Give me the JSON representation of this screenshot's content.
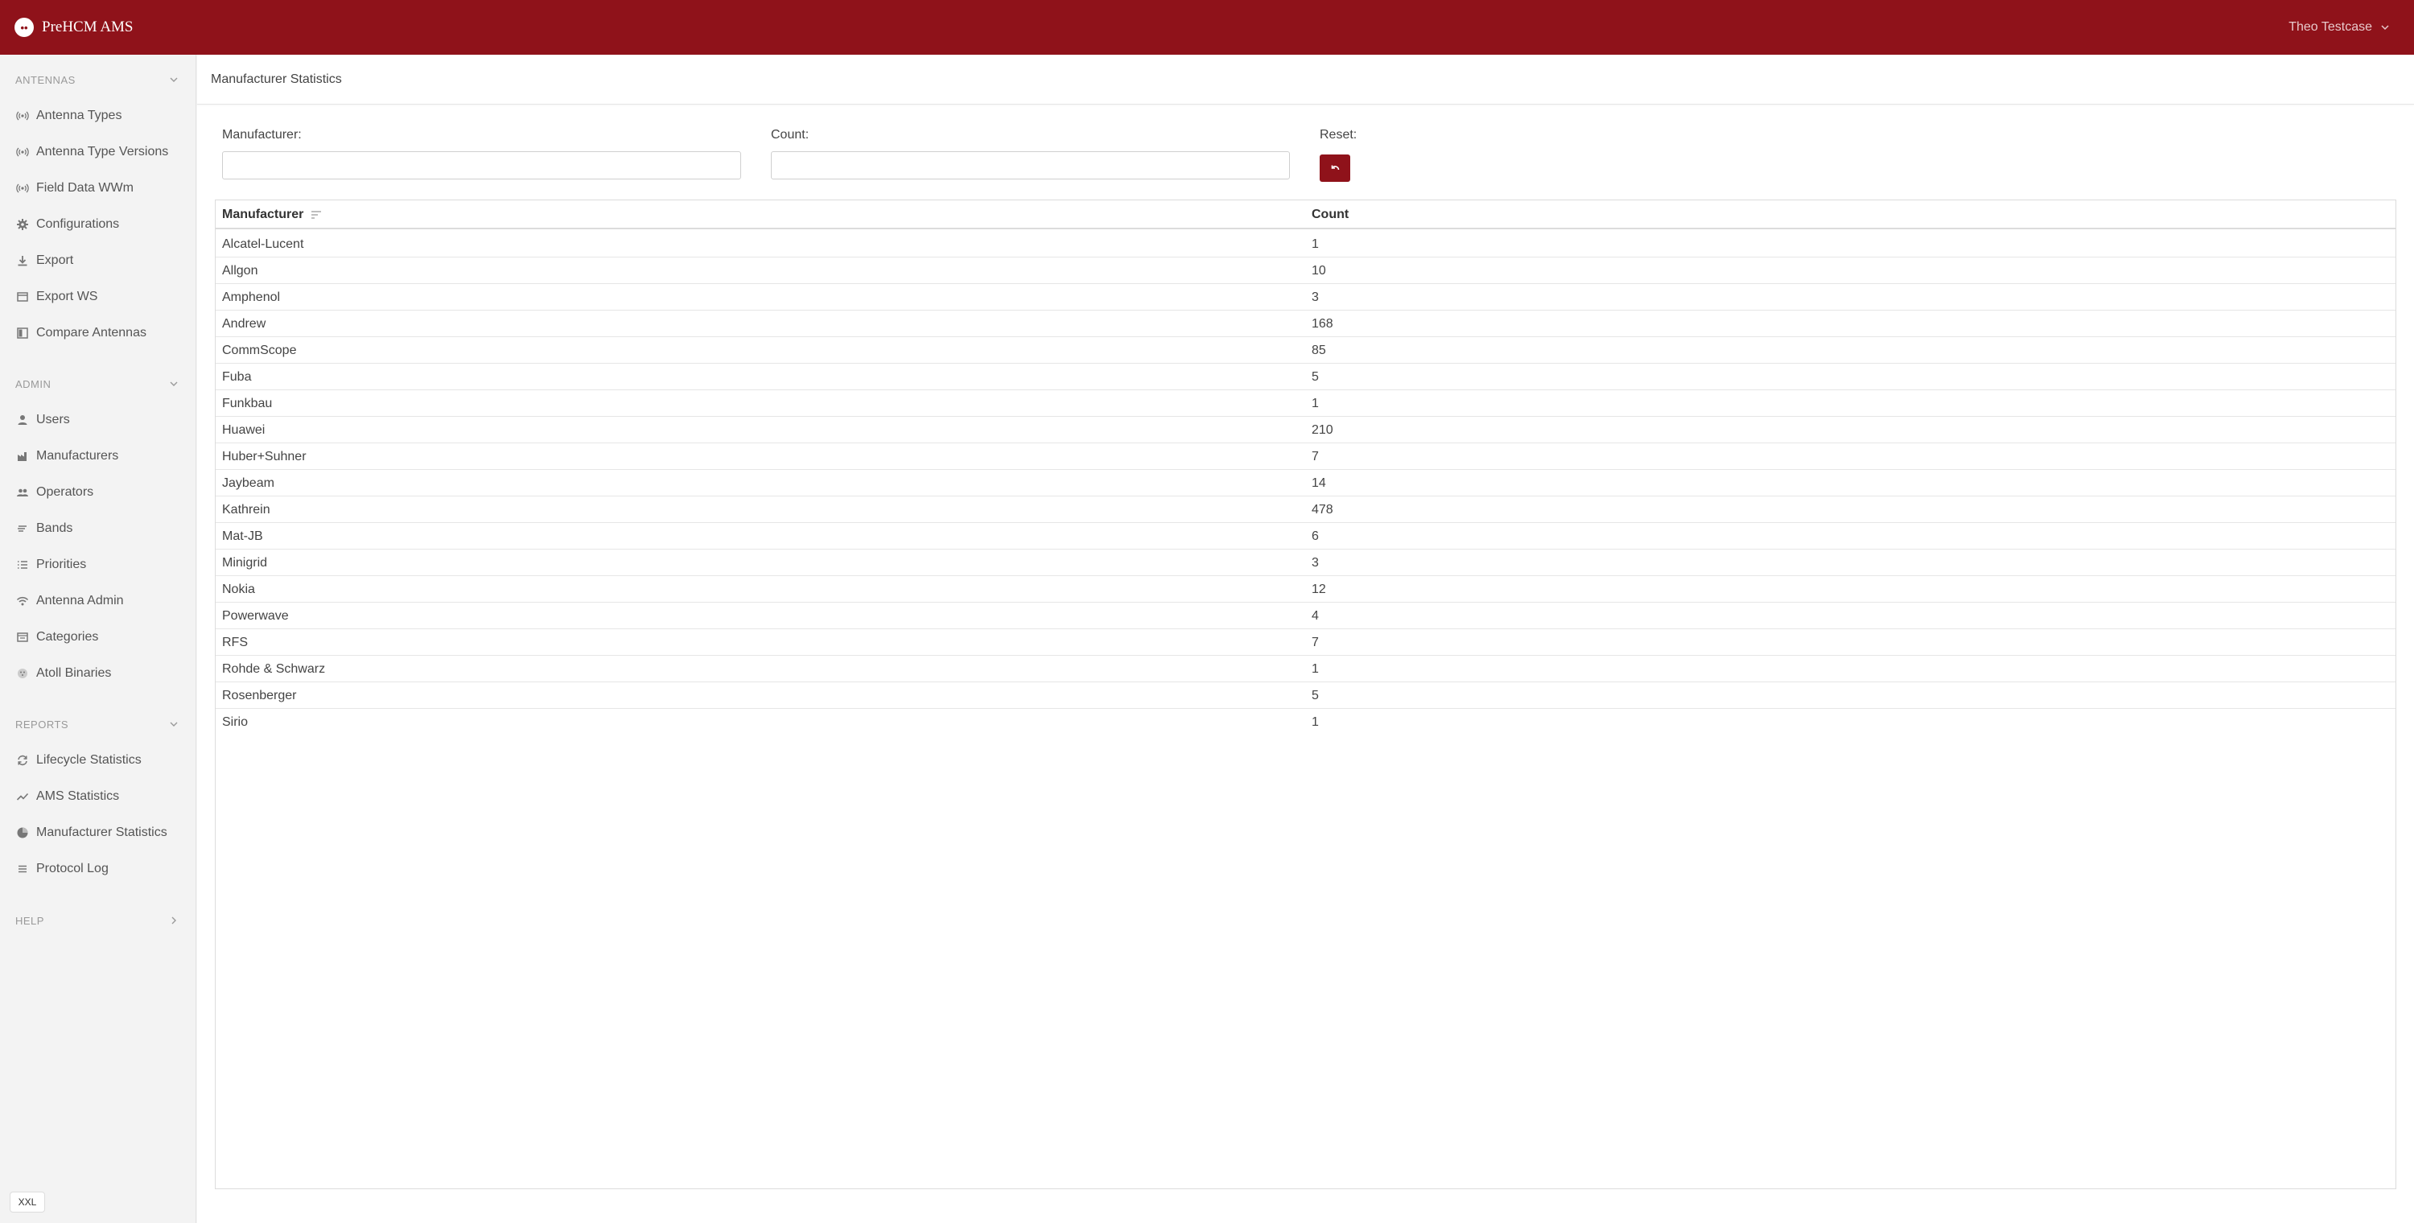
{
  "app": {
    "title": "PreHCM AMS",
    "logo_glyph": "••",
    "user_name": "Theo Testcase",
    "accent_color": "#8f121a"
  },
  "sidebar": {
    "sections": [
      {
        "title": "ANTENNAS",
        "expanded": true,
        "items": [
          {
            "label": "Antenna Types",
            "icon": "antenna-icon"
          },
          {
            "label": "Antenna Type Versions",
            "icon": "antenna-icon"
          },
          {
            "label": "Field Data WWm",
            "icon": "antenna-icon"
          },
          {
            "label": "Configurations",
            "icon": "gear-icon"
          },
          {
            "label": "Export",
            "icon": "download-icon"
          },
          {
            "label": "Export WS",
            "icon": "window-icon"
          },
          {
            "label": "Compare Antennas",
            "icon": "compare-icon"
          }
        ]
      },
      {
        "title": "ADMIN",
        "expanded": true,
        "items": [
          {
            "label": "Users",
            "icon": "user-icon"
          },
          {
            "label": "Manufacturers",
            "icon": "factory-icon"
          },
          {
            "label": "Operators",
            "icon": "group-icon"
          },
          {
            "label": "Bands",
            "icon": "bands-icon"
          },
          {
            "label": "Priorities",
            "icon": "list-icon"
          },
          {
            "label": "Antenna Admin",
            "icon": "wifi-icon"
          },
          {
            "label": "Categories",
            "icon": "window-icon"
          },
          {
            "label": "Atoll Binaries",
            "icon": "dots-icon"
          }
        ]
      },
      {
        "title": "REPORTS",
        "expanded": true,
        "items": [
          {
            "label": "Lifecycle Statistics",
            "icon": "cycle-icon"
          },
          {
            "label": "AMS Statistics",
            "icon": "trend-icon"
          },
          {
            "label": "Manufacturer Statistics",
            "icon": "pie-icon"
          },
          {
            "label": "Protocol Log",
            "icon": "log-icon"
          }
        ]
      },
      {
        "title": "HELP",
        "expanded": false,
        "items": []
      }
    ],
    "viewport_badge": "XXL"
  },
  "main": {
    "page_title": "Manufacturer Statistics",
    "filters": {
      "manufacturer_label": "Manufacturer:",
      "manufacturer_value": "",
      "count_label": "Count:",
      "count_value": "",
      "reset_label": "Reset:"
    },
    "table": {
      "columns": [
        "Manufacturer",
        "Count"
      ],
      "rows": [
        [
          "Alcatel-Lucent",
          "1"
        ],
        [
          "Allgon",
          "10"
        ],
        [
          "Amphenol",
          "3"
        ],
        [
          "Andrew",
          "168"
        ],
        [
          "CommScope",
          "85"
        ],
        [
          "Fuba",
          "5"
        ],
        [
          "Funkbau",
          "1"
        ],
        [
          "Huawei",
          "210"
        ],
        [
          "Huber+Suhner",
          "7"
        ],
        [
          "Jaybeam",
          "14"
        ],
        [
          "Kathrein",
          "478"
        ],
        [
          "Mat-JB",
          "6"
        ],
        [
          "Minigrid",
          "3"
        ],
        [
          "Nokia",
          "12"
        ],
        [
          "Powerwave",
          "4"
        ],
        [
          "RFS",
          "7"
        ],
        [
          "Rohde & Schwarz",
          "1"
        ],
        [
          "Rosenberger",
          "5"
        ],
        [
          "Sirio",
          "1"
        ]
      ]
    }
  }
}
